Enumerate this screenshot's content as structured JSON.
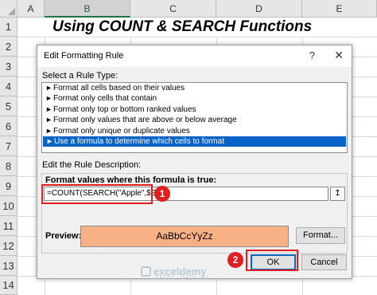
{
  "sheet": {
    "columns": [
      "A",
      "B",
      "C",
      "D",
      "E"
    ],
    "selected_column": "B",
    "rows": [
      "1",
      "2",
      "3",
      "4",
      "5",
      "6",
      "7",
      "8",
      "9",
      "10",
      "11",
      "12",
      "13",
      "14"
    ],
    "title": "Using COUNT & SEARCH Functions"
  },
  "dialog": {
    "title": "Edit Formatting Rule",
    "help_icon": "?",
    "close_icon": "✕",
    "select_rule_type_label": "Select a Rule Type:",
    "rule_types": [
      "Format all cells based on their values",
      "Format only cells that contain",
      "Format only top or bottom ranked values",
      "Format only values that are above or below average",
      "Format only unique or duplicate values",
      "Use a formula to determine which cells to format"
    ],
    "selected_rule_index": 5,
    "edit_description_label": "Edit the Rule Description:",
    "formula_label": "Format values where this formula is true:",
    "formula_value": "=COUNT(SEARCH(\"Apple\",$B4))",
    "collapse_icon": "↥",
    "preview_label": "Preview:",
    "preview_text": "AaBbCcYyZz",
    "preview_fill": "#f8b085",
    "format_button": "Format...",
    "ok_button": "OK",
    "cancel_button": "Cancel"
  },
  "callouts": [
    {
      "number": "1",
      "color": "#e02020"
    },
    {
      "number": "2",
      "color": "#e02020"
    }
  ],
  "watermark": {
    "name": "exceldemy",
    "tagline": "EXCEL · DATA · BI"
  }
}
